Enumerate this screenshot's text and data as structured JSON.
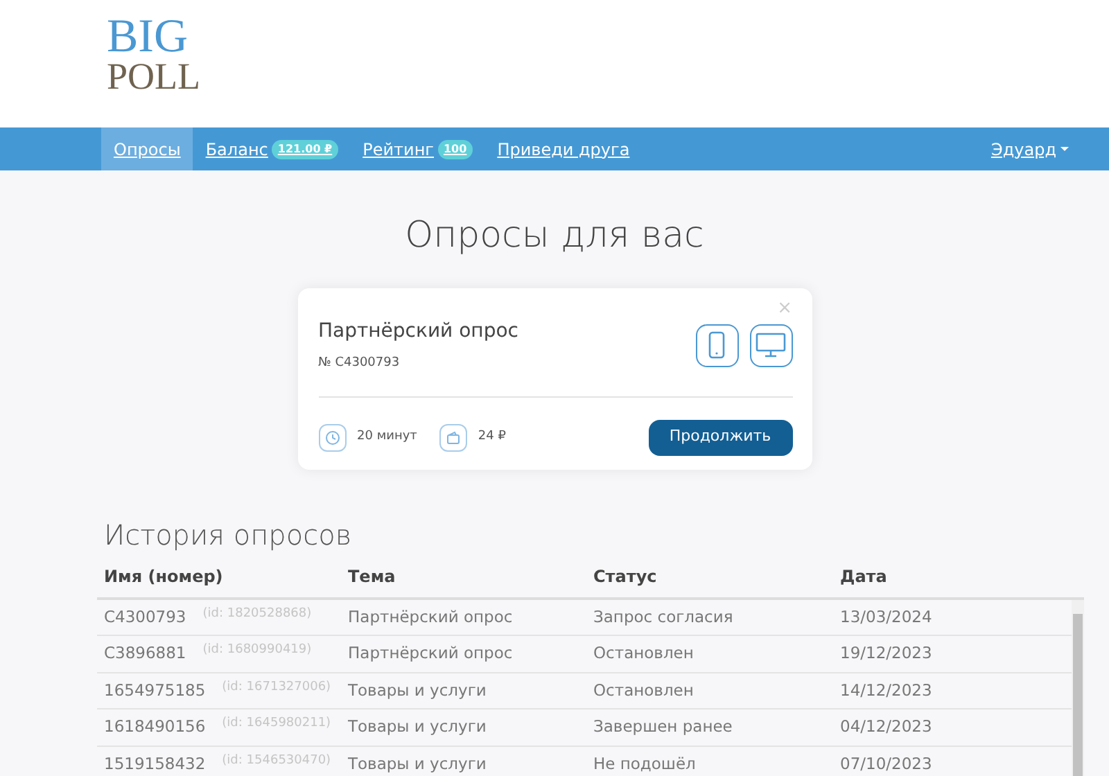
{
  "logo": {
    "line_1": "BIG",
    "line_2": "POLL"
  },
  "nav": [
    {
      "label": "Опросы",
      "selected": true
    },
    {
      "label": "Баланс",
      "badge": "121.00 ₽",
      "selected": false
    },
    {
      "label": "Рейтинг",
      "badge": "100",
      "selected": false
    },
    {
      "label": "Приведи друга",
      "selected": false
    }
  ],
  "user_menu": {
    "label": "Эдуард"
  },
  "page_title": "Опросы для вас",
  "survey_card": {
    "close": "×",
    "title": "Партнёрский опрос",
    "number": "№ C4300793",
    "duration": "20 минут",
    "reward": "24 ₽",
    "button": "Продолжить"
  },
  "history": {
    "title": "История опросов",
    "columns": [
      "Имя (номер)",
      "Тема",
      "Статус",
      "Дата"
    ],
    "rows": [
      {
        "name": "C4300793",
        "id": "(id: 1820528868)",
        "topic": "Партнёрский опрос",
        "status": "Запрос согласия",
        "date": "13/03/2024"
      },
      {
        "name": "C3896881",
        "id": "(id: 1680990419)",
        "topic": "Партнёрский опрос",
        "status": "Остановлен",
        "date": "19/12/2023"
      },
      {
        "name": "1654975185",
        "id": "(id: 1671327006)",
        "topic": "Товары и услуги",
        "status": "Остановлен",
        "date": "14/12/2023"
      },
      {
        "name": "1618490156",
        "id": "(id: 1645980211)",
        "topic": "Товары и услуги",
        "status": "Завершен ранее",
        "date": "04/12/2023"
      },
      {
        "name": "1519158432",
        "id": "(id: 1546530470)",
        "topic": "Товары и услуги",
        "status": "Не подошёл",
        "date": "07/10/2023"
      }
    ]
  }
}
